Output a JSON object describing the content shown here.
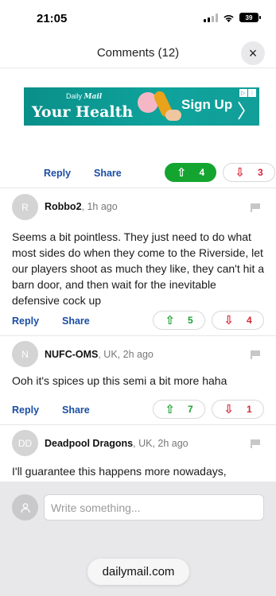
{
  "status_bar": {
    "time": "21:05",
    "battery": "39"
  },
  "header": {
    "title": "Comments (12)",
    "close_icon": "×"
  },
  "ad": {
    "brand_prefix": "Daily",
    "brand_name": "Mail",
    "headline": "Your Health",
    "cta": "Sign Up",
    "arrow": "〉",
    "badge_play": "▷",
    "badge_menu": "⋮"
  },
  "top_actions": {
    "reply": "Reply",
    "share": "Share",
    "up_count": "4",
    "down_count": "3",
    "up_arrow": "⇧",
    "down_arrow": "⇩"
  },
  "comments": [
    {
      "initials": "R",
      "name": "Robbo2",
      "meta": ", 1h ago",
      "text": "Seems a bit pointless. They just need to do what most sides do when they come to the Riverside, let our players shoot as much they like, they can't hit a barn door, and then wait for the inevitable defensive cock up",
      "reply": "Reply",
      "share": "Share",
      "up_count": "5",
      "down_count": "4"
    },
    {
      "initials": "N",
      "name": "NUFC-OMS",
      "meta": ", UK, 2h ago",
      "text": "Ooh it's spices up this semi a bit more haha",
      "reply": "Reply",
      "share": "Share",
      "up_count": "7",
      "down_count": "1"
    },
    {
      "initials": "DD",
      "name": "Deadpool Dragons",
      "meta": ", UK, 2h ago",
      "text": "I'll guarantee this happens more nowadays,"
    }
  ],
  "composer": {
    "placeholder": "Write something..."
  },
  "browser": {
    "url": "dailymail.com"
  },
  "colors": {
    "accent_blue": "#1b4ea3",
    "upvote_green": "#14a530",
    "downvote_red": "#d8253a",
    "ad_teal": "#0fa39c"
  }
}
